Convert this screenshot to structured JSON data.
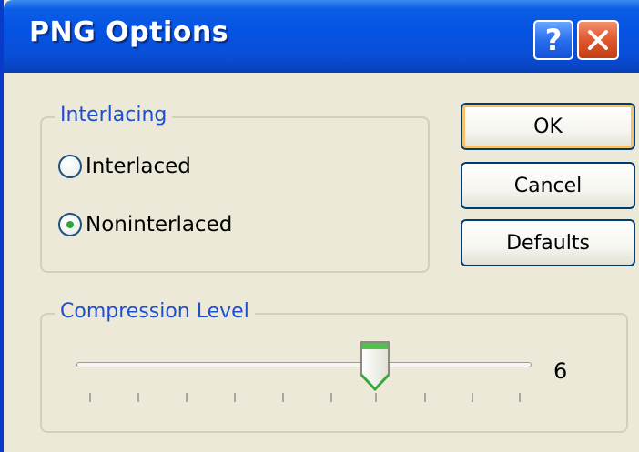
{
  "dialog": {
    "title": "PNG Options",
    "help_label": "?",
    "close_icon": "close-x-icon"
  },
  "interlacing": {
    "legend": "Interlacing",
    "options": [
      {
        "label": "Interlaced",
        "checked": false
      },
      {
        "label": "Noninterlaced",
        "checked": true
      }
    ]
  },
  "buttons": {
    "ok": "OK",
    "cancel": "Cancel",
    "defaults": "Defaults"
  },
  "compression": {
    "legend": "Compression Level",
    "min": 0,
    "max": 9,
    "value": 6,
    "value_label": "6"
  },
  "colors": {
    "accent_title": "#0553e2",
    "group_legend": "#1f4ed0",
    "close_red": "#e15b32",
    "radio_dot": "#2fa63a"
  }
}
